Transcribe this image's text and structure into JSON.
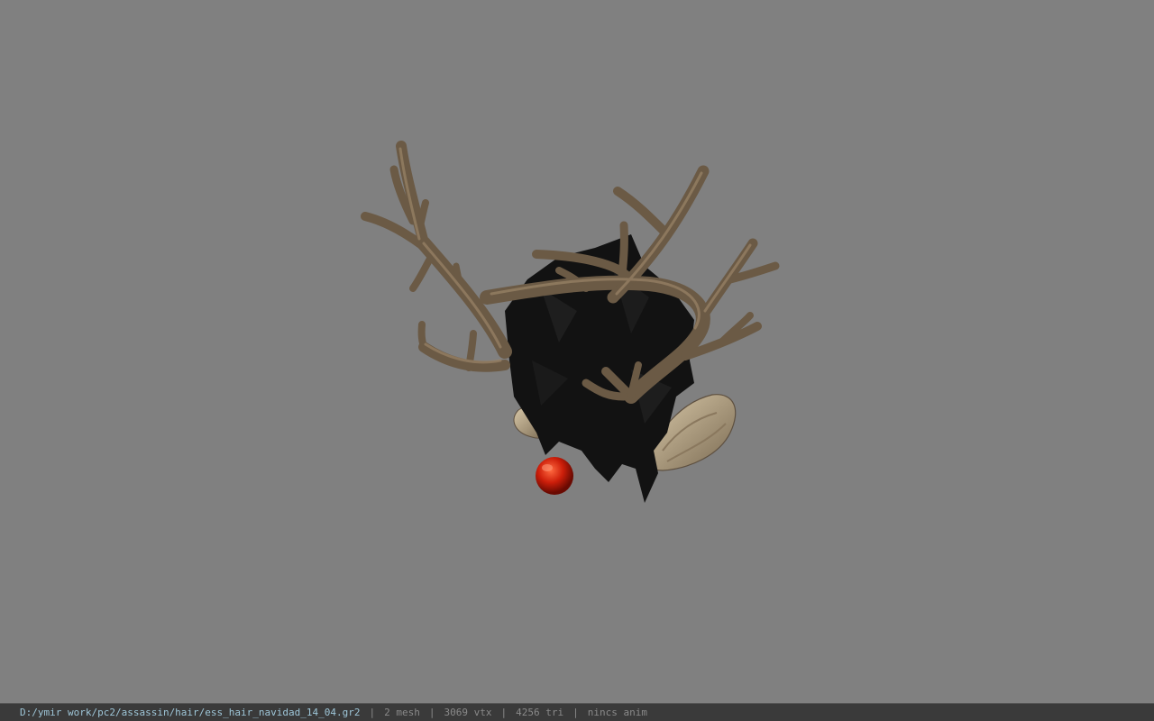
{
  "viewer": {
    "background_color": "#808080",
    "model": {
      "description_icon": "antler-hair-model-icon",
      "colors": {
        "antler": "#6b5a45",
        "antler_highlight": "#9a8468",
        "hair": "#111111",
        "nose": "#cc1e0a",
        "ear": "#b3a287"
      }
    }
  },
  "status_bar": {
    "file_path": "D:/ymir work/pc2/assassin/hair/ess_hair_navidad_14_04.gr2",
    "separator": "|",
    "mesh": "2 mesh",
    "vertices": "3069 vtx",
    "triangles": "4256 tri",
    "anim": "nincs anim",
    "path_color": "#9ec6d8",
    "text_color": "#8a8a8a"
  }
}
